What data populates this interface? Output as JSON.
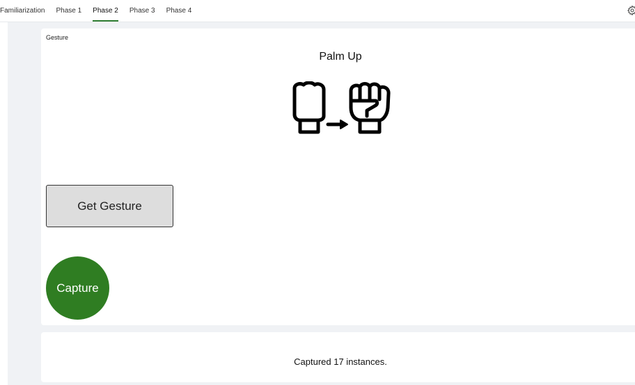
{
  "tabs": [
    {
      "label": "Familiarization",
      "active": false
    },
    {
      "label": "Phase 1",
      "active": false
    },
    {
      "label": "Phase 2",
      "active": true
    },
    {
      "label": "Phase 3",
      "active": false
    },
    {
      "label": "Phase 4",
      "active": false
    }
  ],
  "header": {
    "settings_icon": "gear-icon"
  },
  "gesture_card": {
    "label": "Gesture",
    "gesture_name": "Palm Up",
    "art_icons": [
      "fist-side-icon",
      "arrow-right-icon",
      "fist-front-icon"
    ],
    "get_gesture_label": "Get Gesture",
    "capture_label": "Capture"
  },
  "status_card": {
    "message": "Captured 17 instances."
  },
  "colors": {
    "accent": "#2e7d32",
    "capture_button": "#2f7d22",
    "get_gesture_button": "#dddddd",
    "page_background": "#f0f2f5"
  }
}
